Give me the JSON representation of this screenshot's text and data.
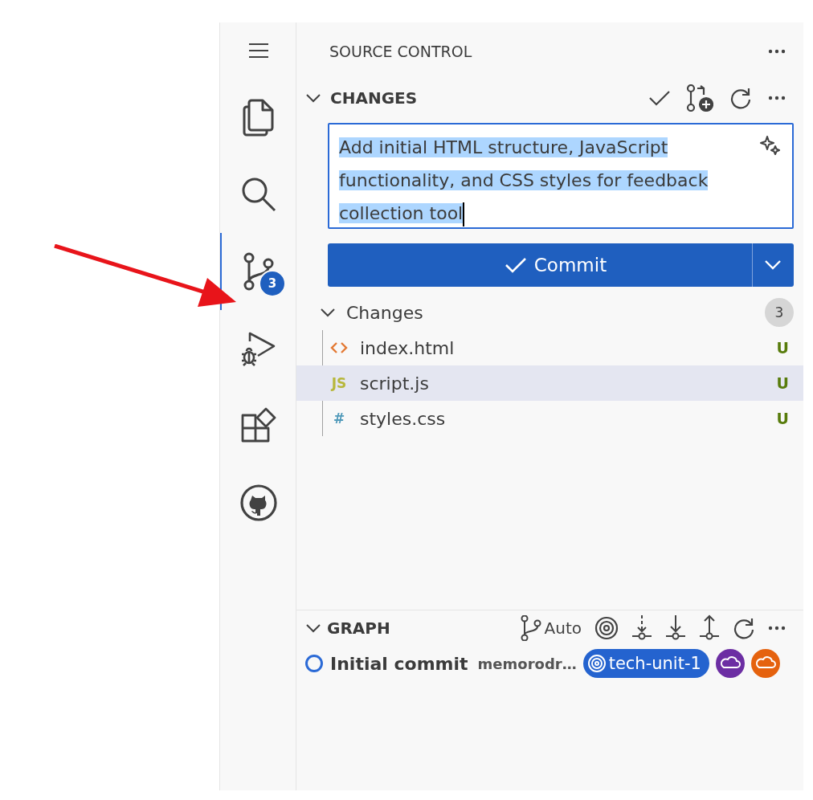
{
  "activity_bar": {
    "items": [
      {
        "kind": "menu",
        "selected": false
      },
      {
        "kind": "explorer",
        "selected": false
      },
      {
        "kind": "search",
        "selected": false
      },
      {
        "kind": "source-control",
        "selected": true,
        "badge": "3"
      },
      {
        "kind": "run-debug",
        "selected": false
      },
      {
        "kind": "extensions",
        "selected": false
      },
      {
        "kind": "github",
        "selected": false
      }
    ]
  },
  "sidebar": {
    "title": "SOURCE CONTROL"
  },
  "changes_section": {
    "title": "CHANGES",
    "expanded": true
  },
  "commit_message": {
    "value": "Add initial HTML structure, JavaScript functionality, and CSS styles for feedback collection tool",
    "selected": true
  },
  "commit_button": {
    "label": "Commit"
  },
  "changes_group": {
    "label": "Changes",
    "expanded": true,
    "count": "3",
    "files": [
      {
        "name": "index.html",
        "kind": "html",
        "status": "U",
        "selected": false
      },
      {
        "name": "script.js",
        "kind": "js",
        "icon": "JS",
        "status": "U",
        "selected": true
      },
      {
        "name": "styles.css",
        "kind": "css",
        "icon": "#",
        "status": "U",
        "selected": false
      }
    ]
  },
  "graph": {
    "title": "GRAPH",
    "expanded": true,
    "mode": "Auto",
    "commits": [
      {
        "message": "Initial commit",
        "author": "memorodr…",
        "branch": "tech-unit-1"
      }
    ]
  }
}
